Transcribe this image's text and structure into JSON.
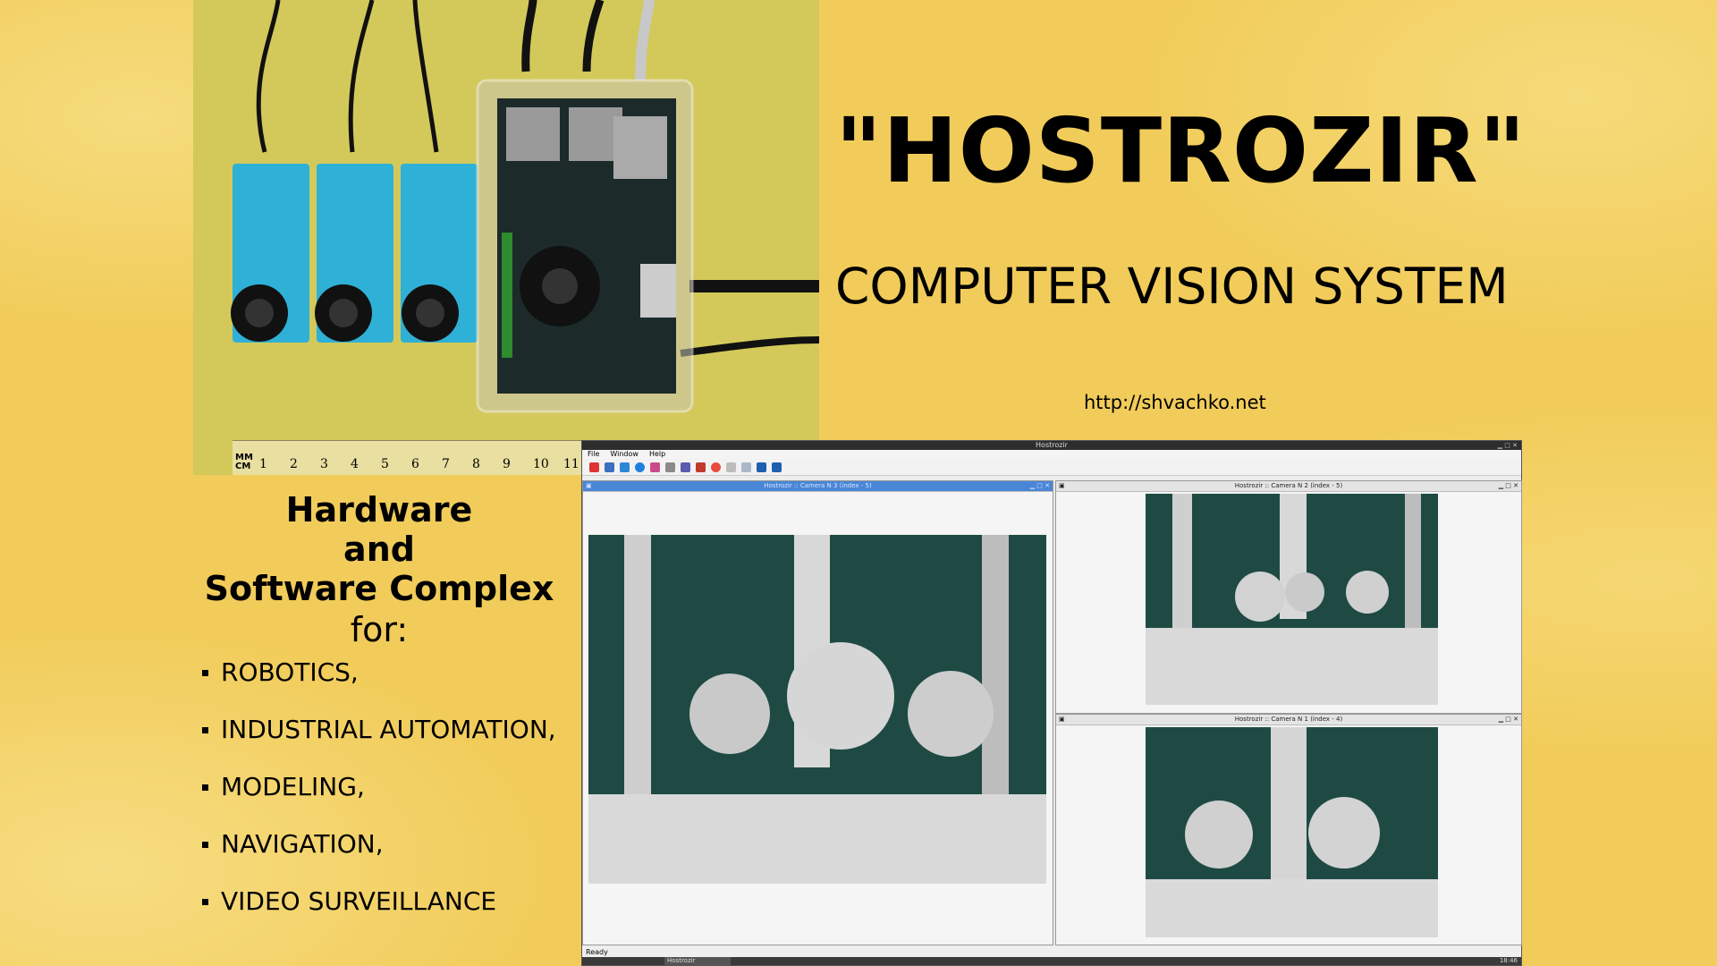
{
  "title": "\"HOSTROZIR\"",
  "subtitle": "COMPUTER VISION SYSTEM",
  "url": "http://shvachko.net",
  "hardware": {
    "heading_lines": [
      "Hardware",
      "and",
      "Software Complex"
    ],
    "for": "for:",
    "items": [
      "ROBOTICS,",
      "INDUSTRIAL AUTOMATION,",
      "MODELING,",
      "NAVIGATION,",
      "VIDEO SURVEILLANCE"
    ]
  },
  "photo": {
    "ruler_unit": "MM CM",
    "ruler_ticks": [
      "1",
      "2",
      "3",
      "4",
      "5",
      "6",
      "7",
      "8",
      "9",
      "10",
      "11"
    ]
  },
  "app": {
    "window_title": "Hostrozir",
    "menu": [
      "File",
      "Window",
      "Help"
    ],
    "windows": [
      {
        "title": "Hostrozir :: Camera N 3 (index - 5)"
      },
      {
        "title": "Hostrozir :: Camera N 2 (index - 5)"
      },
      {
        "title": "Hostrozir :: Camera N 1 (index - 4)"
      }
    ],
    "status": "Ready",
    "taskbar_task": "Hostrozir",
    "clock": "18:46"
  },
  "colors": {
    "background": "#f1cc5a",
    "camera_body": "#2fb0d6",
    "board": "#1c2a2a"
  }
}
